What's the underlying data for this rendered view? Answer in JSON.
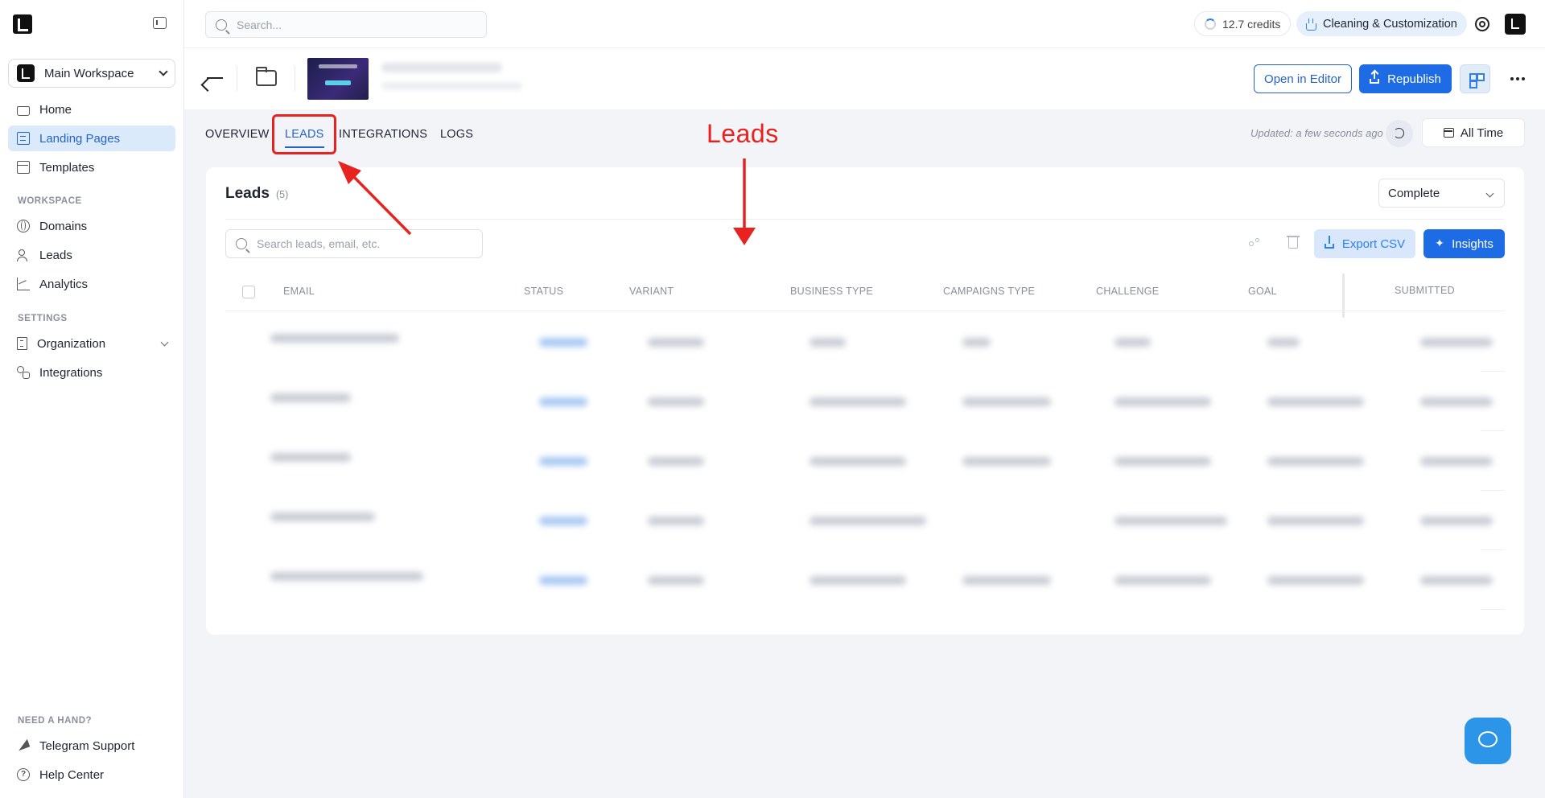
{
  "app": {
    "brand_color": "#1e6be6",
    "accent_light": "#dbeafb"
  },
  "sidebar": {
    "workspace": "Main Workspace",
    "items": [
      {
        "label": "Home",
        "icon": "home-icon"
      },
      {
        "label": "Landing Pages",
        "icon": "landing-pages-icon",
        "active": true
      },
      {
        "label": "Templates",
        "icon": "templates-icon"
      }
    ],
    "workspace_section": "WORKSPACE",
    "workspace_items": [
      {
        "label": "Domains",
        "icon": "globe-icon"
      },
      {
        "label": "Leads",
        "icon": "users-icon"
      },
      {
        "label": "Analytics",
        "icon": "chart-icon"
      }
    ],
    "settings_section": "SETTINGS",
    "settings_items": [
      {
        "label": "Organization",
        "icon": "building-icon"
      },
      {
        "label": "Integrations",
        "icon": "integrations-icon"
      }
    ],
    "help_section": "NEED A HAND?",
    "help_items": [
      {
        "label": "Telegram Support",
        "icon": "send-icon"
      },
      {
        "label": "Help Center",
        "icon": "help-icon"
      }
    ]
  },
  "topbar": {
    "search_placeholder": "Search...",
    "credits": "12.7 credits",
    "mode": "Cleaning & Customization"
  },
  "page_header": {
    "open_editor": "Open in Editor",
    "republish": "Republish"
  },
  "tabs": [
    {
      "label": "OVERVIEW"
    },
    {
      "label": "LEADS",
      "active": true
    },
    {
      "label": "INTEGRATIONS"
    },
    {
      "label": "LOGS"
    }
  ],
  "updated": "Updated: a few seconds ago",
  "range": "All Time",
  "leads_card": {
    "title": "Leads",
    "count": "(5)",
    "filter": "Complete",
    "search_placeholder": "Search leads, email, etc.",
    "export": "Export CSV",
    "insights": "Insights",
    "columns": [
      "EMAIL",
      "STATUS",
      "VARIANT",
      "BUSINESS TYPE",
      "CAMPAIGNS TYPE",
      "CHALLENGE",
      "GOAL",
      "SUBMITTED"
    ],
    "row_count": 5
  },
  "annotation": {
    "label": "Leads"
  }
}
